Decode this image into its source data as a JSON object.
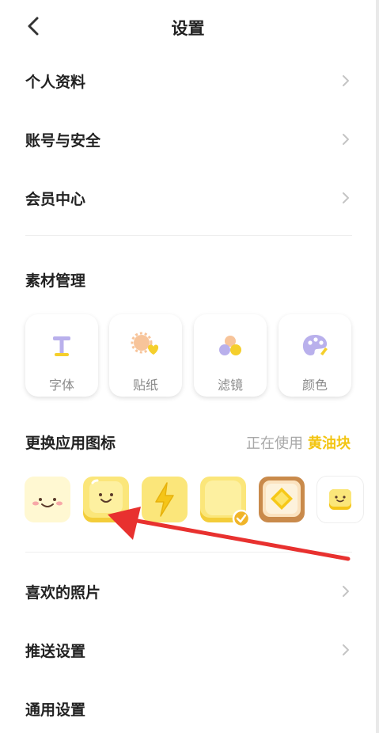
{
  "header": {
    "title": "设置"
  },
  "menu_top": [
    {
      "label": "个人资料"
    },
    {
      "label": "账号与安全"
    },
    {
      "label": "会员中心"
    }
  ],
  "materials": {
    "title": "素材管理",
    "tools": [
      {
        "label": "字体",
        "icon": "font-icon"
      },
      {
        "label": "贴纸",
        "icon": "sticker-icon"
      },
      {
        "label": "滤镜",
        "icon": "filter-icon"
      },
      {
        "label": "颜色",
        "icon": "palette-icon"
      }
    ]
  },
  "app_icon": {
    "title": "更换应用图标",
    "in_use_prefix": "正在使用",
    "in_use_name": "黄油块",
    "options": [
      "blush-face-icon",
      "smile-butter-icon",
      "lightning-icon",
      "plain-butter-icon",
      "toast-butter-icon",
      "mini-butter-icon"
    ],
    "selected_index": 3
  },
  "menu_bottom": [
    {
      "label": "喜欢的照片"
    },
    {
      "label": "推送设置"
    },
    {
      "label": "通用设置"
    }
  ],
  "colors": {
    "accent": "#f3c512",
    "arrow": "#e8312f"
  }
}
